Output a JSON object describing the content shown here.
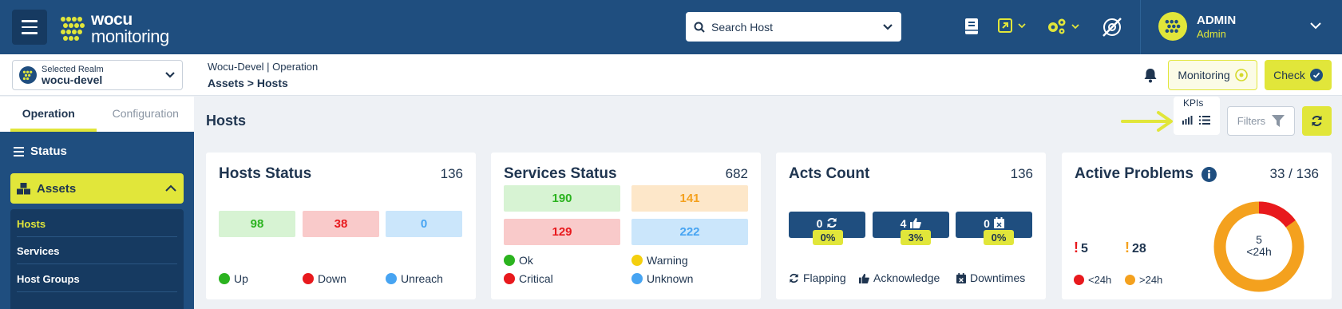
{
  "colors": {
    "primary": "#1f4e7f",
    "accent": "#e1e63a",
    "up": "#2bb31f",
    "down": "#e8191d",
    "unreach": "#47a4f2",
    "warning": "#f4cf0e",
    "orange": "#f4a11e"
  },
  "header": {
    "logo_line1": "wocu",
    "logo_line2": "monitoring",
    "search_placeholder": "Search Host",
    "user_name": "ADMIN",
    "user_role": "Admin"
  },
  "subbar": {
    "realm_caption": "Selected Realm",
    "realm_value": "wocu-devel",
    "breadcrumb_top": "Wocu-Devel | Operation",
    "breadcrumb_bottom": "Assets > Hosts",
    "monitoring_label": "Monitoring",
    "check_label": "Check"
  },
  "sidebar": {
    "tabs": [
      "Operation",
      "Configuration"
    ],
    "status_label": "Status",
    "assets_label": "Assets",
    "sub_items": [
      "Hosts",
      "Services",
      "Host Groups"
    ]
  },
  "main": {
    "title": "Hosts",
    "kpis_label": "KPIs",
    "filters_label": "Filters"
  },
  "hosts_status": {
    "title": "Hosts Status",
    "total": "136",
    "up": "98",
    "down": "38",
    "unreach": "0",
    "legend": [
      "Up",
      "Down",
      "Unreach"
    ]
  },
  "services_status": {
    "title": "Services Status",
    "total": "682",
    "ok": "190",
    "warning": "141",
    "critical": "129",
    "unknown": "222",
    "legend": [
      "Ok",
      "Warning",
      "Critical",
      "Unknown"
    ]
  },
  "acts_count": {
    "title": "Acts Count",
    "total": "136",
    "flapping": "0",
    "acknowledge": "4",
    "downtimes": "0",
    "flapping_pct": "0%",
    "acknowledge_pct": "3%",
    "downtimes_pct": "0%",
    "legend": [
      "Flapping",
      "Acknowledge",
      "Downtimes"
    ]
  },
  "active_problems": {
    "title": "Active Problems",
    "ratio": "33 / 136",
    "recent": "5",
    "older": "28",
    "donut_value": "5",
    "donut_label": "<24h",
    "recent_fraction": 0.15,
    "legend": [
      "<24h",
      ">24h"
    ]
  }
}
